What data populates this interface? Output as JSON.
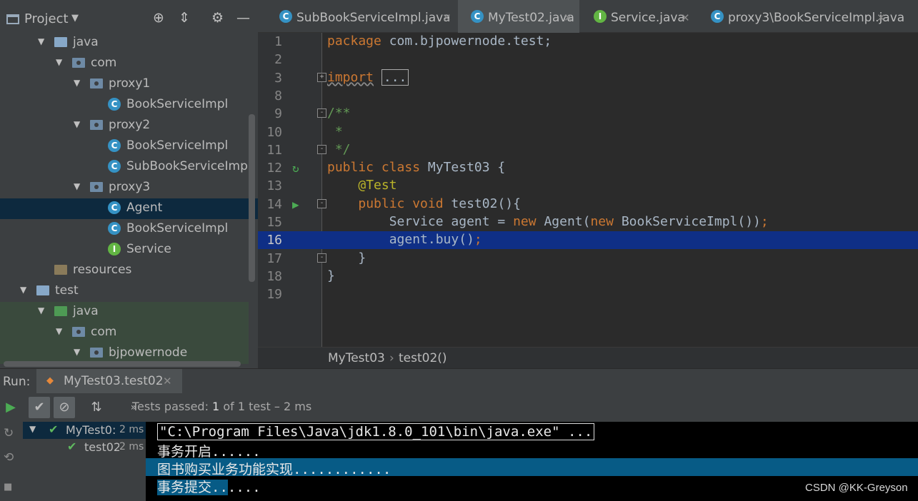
{
  "project": {
    "title": "Project",
    "tree": [
      {
        "label": "java",
        "icon": "source-folder-icon",
        "arrow": "▼",
        "indent": 0
      },
      {
        "label": "com",
        "icon": "package-icon",
        "arrow": "▼",
        "indent": 1
      },
      {
        "label": "proxy1",
        "icon": "package-icon",
        "arrow": "▼",
        "indent": 2
      },
      {
        "label": "BookServiceImpl",
        "icon": "class-icon",
        "arrow": "",
        "indent": 3
      },
      {
        "label": "proxy2",
        "icon": "package-icon",
        "arrow": "▼",
        "indent": 2
      },
      {
        "label": "BookServiceImpl",
        "icon": "class-icon",
        "arrow": "",
        "indent": 3
      },
      {
        "label": "SubBookServiceImpl",
        "icon": "class-icon",
        "arrow": "",
        "indent": 3
      },
      {
        "label": "proxy3",
        "icon": "package-icon",
        "arrow": "▼",
        "indent": 2
      },
      {
        "label": "Agent",
        "icon": "class-icon",
        "arrow": "",
        "indent": 3,
        "selected": true
      },
      {
        "label": "BookServiceImpl",
        "icon": "class-icon",
        "arrow": "",
        "indent": 3
      },
      {
        "label": "Service",
        "icon": "interface-icon",
        "arrow": "",
        "indent": 3
      },
      {
        "label": "resources",
        "icon": "resources-folder-icon",
        "arrow": "",
        "indent": 0
      },
      {
        "label": "test",
        "icon": "folder-icon",
        "arrow": "▼",
        "indent": -1
      },
      {
        "label": "java",
        "icon": "test-source-folder-icon",
        "arrow": "▼",
        "indent": 0,
        "green": true
      },
      {
        "label": "com",
        "icon": "package-icon",
        "arrow": "▼",
        "indent": 1,
        "green": true
      },
      {
        "label": "bjpowernode",
        "icon": "package-icon",
        "arrow": "▼",
        "indent": 2,
        "green": true
      }
    ]
  },
  "tabs": [
    {
      "label": "SubBookServiceImpl.java",
      "icon": "class-icon",
      "icon_glyph": "C"
    },
    {
      "label": "MyTest02.java",
      "icon": "test-class-icon",
      "icon_glyph": "C",
      "active": true
    },
    {
      "label": "Service.java",
      "icon": "interface-icon",
      "icon_glyph": "I"
    },
    {
      "label": "proxy3\\BookServiceImpl.java",
      "icon": "class-icon",
      "icon_glyph": "C"
    }
  ],
  "editor": {
    "lines": [
      {
        "n": "1",
        "html": "<span class='kw'>package</span> com.bjpowernode.test;"
      },
      {
        "n": "2",
        "html": ""
      },
      {
        "n": "3",
        "html": "<span class='kw squig'>import</span> <span class='import-box'>...</span>",
        "fold": "+"
      },
      {
        "n": "8",
        "html": ""
      },
      {
        "n": "9",
        "html": "<span class='cmt'>/**</span>",
        "fold": "-"
      },
      {
        "n": "10",
        "html": "<span class='cmt'> *</span>"
      },
      {
        "n": "11",
        "html": "<span class='cmt'> */</span>",
        "fold": "-"
      },
      {
        "n": "12",
        "html": "<span class='kw'>public class</span> MyTest03 {",
        "run": "↻"
      },
      {
        "n": "13",
        "html": "    <span class='ann'>@Test</span>"
      },
      {
        "n": "14",
        "html": "    <span class='kw'>public void</span> <span class='fn'>test02</span>(){",
        "run": "▶",
        "fold": "-"
      },
      {
        "n": "15",
        "html": "        Service agent = <span class='kw'>new</span> Agent(<span class='kw'>new</span> BookServiceImpl())<span class='kw'>;</span>"
      },
      {
        "n": "16",
        "html": "        agent.buy()<span class='kw'>;</span>",
        "current": true
      },
      {
        "n": "17",
        "html": "    }",
        "fold": "-"
      },
      {
        "n": "18",
        "html": "}"
      },
      {
        "n": "19",
        "html": ""
      }
    ]
  },
  "breadcrumb": {
    "class_name": "MyTest03",
    "separator": "›",
    "method": "test02()"
  },
  "run": {
    "label": "Run:",
    "tab_label": "MyTest03.test02",
    "status_prefix": "Tests passed:",
    "status_count": "1",
    "status_suffix": "of 1 test – 2 ms",
    "tests": [
      {
        "label": "MyTest0:",
        "time": "2 ms",
        "level": 0
      },
      {
        "label": "test02",
        "time": "2 ms",
        "level": 1
      }
    ],
    "console": [
      {
        "text": "\"C:\\Program Files\\Java\\jdk1.8.0_101\\bin\\java.exe\" ...",
        "style": "cmd"
      },
      {
        "text": "事务开启......",
        "style": "plain"
      },
      {
        "text": "图书购买业务功能实现............",
        "style": "full"
      },
      {
        "text_hl": "事务提交..",
        "text_rest": "....",
        "style": "partial"
      }
    ]
  },
  "watermark": "CSDN @KK-Greyson",
  "colors": {
    "selection": "#0d293e",
    "current_line": "#0f2f86",
    "keyword": "#cc7832",
    "annotation": "#bbb529",
    "comment": "#629755",
    "console_highlight": "#075b86"
  }
}
